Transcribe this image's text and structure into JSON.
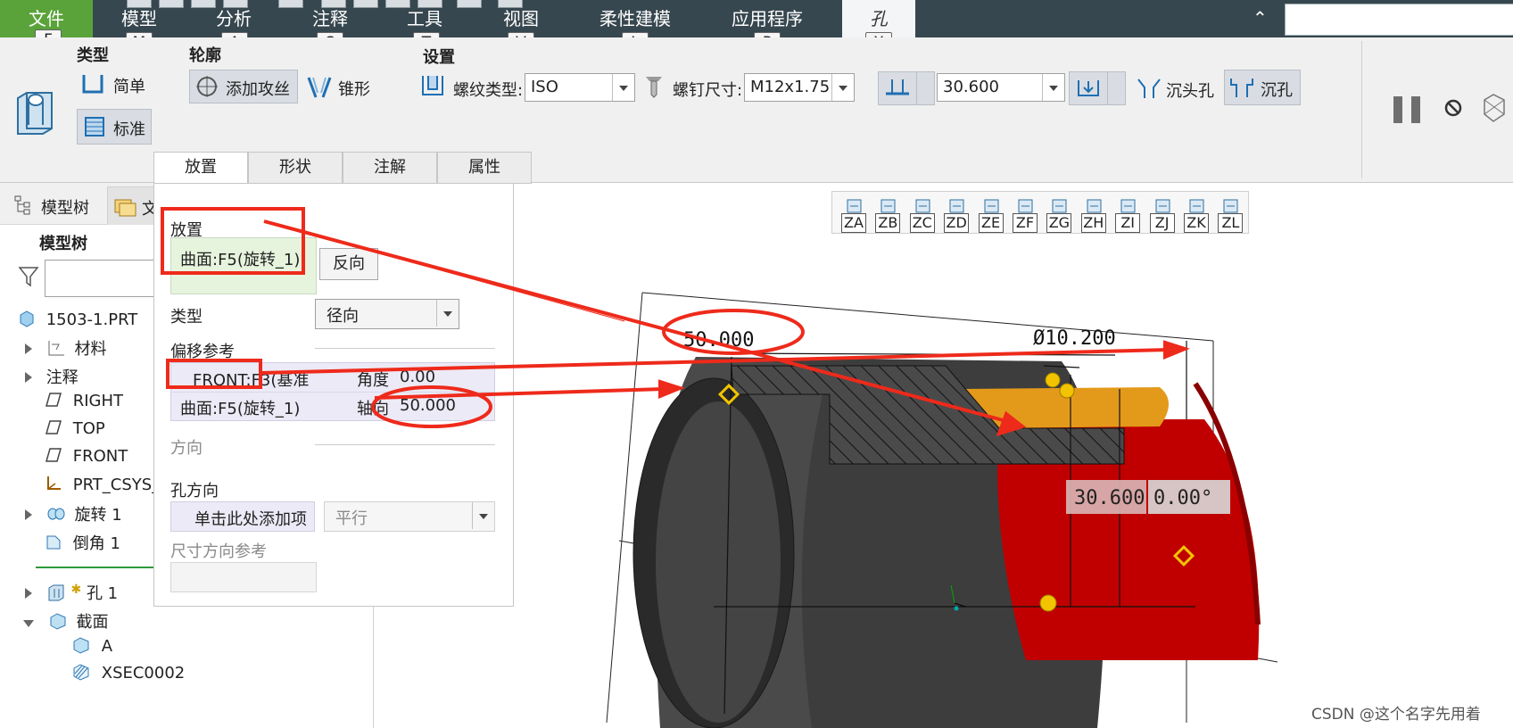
{
  "menu": {
    "file": {
      "label": "文件",
      "key": "F"
    },
    "tabs": [
      {
        "label": "模型",
        "key": "M"
      },
      {
        "label": "分析",
        "key": "A"
      },
      {
        "label": "注释",
        "key": "S"
      },
      {
        "label": "工具",
        "key": "T"
      },
      {
        "label": "视图",
        "key": "V"
      },
      {
        "label": "柔性建模",
        "key": "L"
      },
      {
        "label": "应用程序",
        "key": "P"
      },
      {
        "label": "孔",
        "key": "X"
      }
    ]
  },
  "ribbon": {
    "type_group": "类型",
    "simple": "简单",
    "standard": "标准",
    "profile_group": "轮廓",
    "add_tap": "添加攻丝",
    "taper": "锥形",
    "settings_group": "设置",
    "thread_type_label": "螺纹类型:",
    "thread_type_value": "ISO",
    "screw_size_label": "螺钉尺寸:",
    "screw_size_value": "M12x1.75",
    "depth_value": "30.600",
    "countersink": "沉头孔",
    "counterbore": "沉孔"
  },
  "dialog": {
    "tabs": [
      "放置",
      "形状",
      "注解",
      "属性"
    ],
    "placement_label": "放置",
    "placement_value": "曲面:F5(旋转_1)",
    "flip_button": "反向",
    "type_label": "类型",
    "type_value": "径向",
    "offset_refs_label": "偏移参考",
    "refs": [
      {
        "ref": "FRONT:F3(基准",
        "kind": "角度",
        "value": "0.00"
      },
      {
        "ref": "曲面:F5(旋转_1)",
        "kind": "轴向",
        "value": "50.000"
      }
    ],
    "direction_label": "方向",
    "hole_dir_label": "孔方向",
    "hole_dir_placeholder": "单击此处添加项",
    "hole_dir_mode": "平行",
    "dim_ref_label": "尺寸方向参考"
  },
  "tree": {
    "tab_model": "模型树",
    "tab_other": "文",
    "header": "模型树",
    "items": [
      {
        "label": "1503-1.PRT"
      },
      {
        "label": "材料"
      },
      {
        "label": "注释"
      },
      {
        "label": "RIGHT"
      },
      {
        "label": "TOP"
      },
      {
        "label": "FRONT"
      },
      {
        "label": "PRT_CSYS_"
      },
      {
        "label": "旋转 1"
      },
      {
        "label": "倒角 1"
      },
      {
        "label": "孔 1"
      },
      {
        "label": "截面"
      },
      {
        "label": "A"
      },
      {
        "label": "XSEC0002"
      }
    ]
  },
  "viewbar": {
    "keys": [
      "ZA",
      "ZB",
      "ZC",
      "ZD",
      "ZE",
      "ZF",
      "ZG",
      "ZH",
      "ZI",
      "ZJ",
      "ZK",
      "ZL"
    ]
  },
  "model": {
    "dim_axial": "50.000",
    "dim_diameter": "Ø10.200",
    "dim_depth": "30.600",
    "dim_angle": "0.00°"
  },
  "watermark": "CSDN @这个名字先用着",
  "colors": {
    "menubar": "#37474f",
    "file_menu": "#5aa33a",
    "annotation": "#ee2a1b",
    "hole_surface": "#c00000",
    "cylinder": "#3a3a3a"
  }
}
